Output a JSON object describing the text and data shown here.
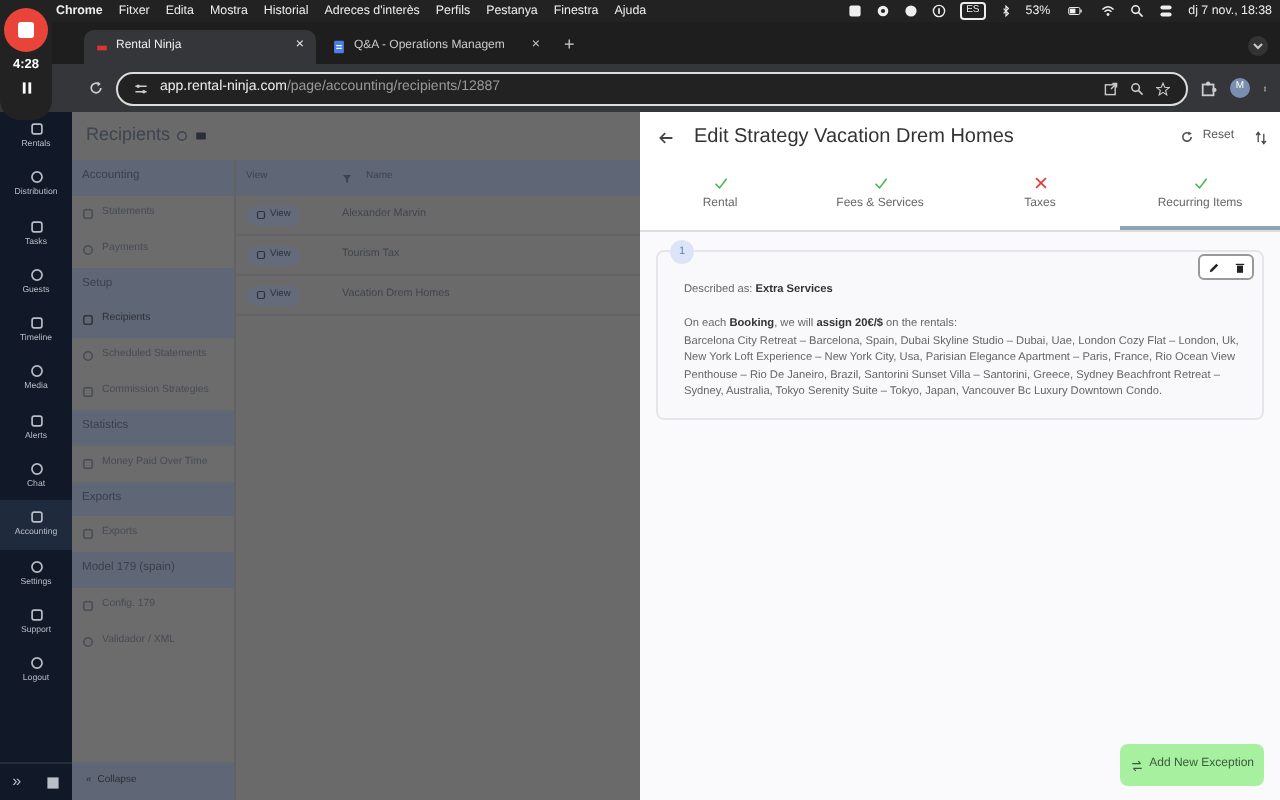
{
  "os_menu_bar": {
    "app": "Chrome",
    "menus": [
      "Fitxer",
      "Edita",
      "Mostra",
      "Historial",
      "Adreces d'interès",
      "Perfils",
      "Pestanya",
      "Finestra",
      "Ajuda"
    ],
    "input_source": "ES",
    "battery": "53%",
    "clock": "dj 7 nov., 18:38"
  },
  "recording": {
    "time": "4:28"
  },
  "browser": {
    "tabs": [
      {
        "title": "Rental Ninja",
        "selected": true,
        "close": "×"
      },
      {
        "title": "Q&A - Operations Managem",
        "selected": false,
        "close": "×"
      }
    ],
    "new_tab": "+",
    "url_host": "app.rental-ninja.com",
    "url_path": "/page/accounting/recipients/12887",
    "profile": "M"
  },
  "sidebar": {
    "items": [
      {
        "label": "Rentals",
        "selected": false
      },
      {
        "label": "Distribution",
        "selected": false
      },
      {
        "label": "Tasks",
        "selected": false
      },
      {
        "label": "Guests",
        "selected": false
      },
      {
        "label": "Timeline",
        "selected": false
      },
      {
        "label": "Media",
        "selected": false
      },
      {
        "label": "Alerts",
        "selected": false
      },
      {
        "label": "Chat",
        "selected": false
      },
      {
        "label": "Accounting",
        "selected": true
      },
      {
        "label": "Settings",
        "selected": false
      },
      {
        "label": "Support",
        "selected": false
      },
      {
        "label": "Logout",
        "selected": false
      }
    ],
    "expand": "»"
  },
  "page": {
    "title": "Recipients",
    "sections": [
      {
        "title": "Accounting",
        "items": [
          {
            "label": "Statements",
            "selected": false
          },
          {
            "label": "Payments",
            "selected": false
          }
        ]
      },
      {
        "title": "Setup",
        "items": [
          {
            "label": "Recipients",
            "selected": true
          },
          {
            "label": "Scheduled Statements",
            "selected": false
          },
          {
            "label": "Commission Strategies",
            "selected": false
          }
        ]
      },
      {
        "title": "Statistics",
        "items": [
          {
            "label": "Money Paid Over Time",
            "selected": false
          }
        ]
      },
      {
        "title": "Exports",
        "items": [
          {
            "label": "Exports",
            "selected": false
          }
        ]
      },
      {
        "title": "Model 179 (spain)",
        "items": [
          {
            "label": "Config. 179",
            "selected": false
          },
          {
            "label": "Validador / XML",
            "selected": false
          }
        ]
      }
    ],
    "collapse_icon": "«",
    "collapse": "Collapse"
  },
  "table": {
    "columns": [
      "View",
      "Name"
    ],
    "rows": [
      {
        "button": "View",
        "name": "Alexander Marvin"
      },
      {
        "button": "View",
        "name": "Tourism Tax"
      },
      {
        "button": "View",
        "name": "Vacation Drem Homes"
      }
    ]
  },
  "drawer": {
    "title": "Edit Strategy Vacation Drem Homes",
    "reset": "Reset",
    "steps": [
      {
        "label": "Rental",
        "complete": true,
        "selected": false
      },
      {
        "label": "Fees & Services",
        "complete": true,
        "selected": false
      },
      {
        "label": "Taxes",
        "complete": false,
        "selected": false
      },
      {
        "label": "Recurring Items",
        "complete": true,
        "selected": true
      }
    ],
    "items": [
      {
        "index": "1",
        "described": "Described as: **Extra Services**",
        "rule": "On each **Booking**, we will **assign 20€/$** on the rentals:",
        "rentals": "Barcelona City Retreat – Barcelona, Spain, Dubai Skyline Studio – Dubai, Uae, London Cozy Flat – London, Uk, New York Loft Experience – New York City, Usa, Parisian Elegance Apartment – Paris, France, Rio Ocean View Penthouse – Rio De Janeiro, Brazil, Santorini Sunset Villa – Santorini, Greece, Sydney Beachfront Retreat – Sydney, Australia, Tokyo Serenity Suite – Tokyo, Japan, Vancouver Bc Luxury Downtown Condo."
      }
    ],
    "add_button": "Add New Exception"
  }
}
